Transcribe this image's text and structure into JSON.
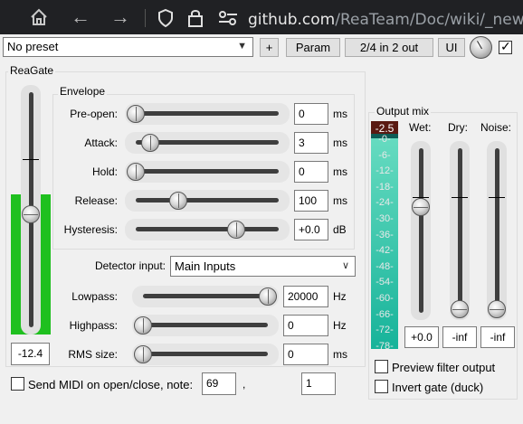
{
  "browser": {
    "url_domain": "github.com",
    "url_path": "/ReaTeam/Doc/wiki/_new"
  },
  "toolbar": {
    "preset": "No preset",
    "plus_label": "+",
    "param_label": "Param",
    "io_label": "2/4 in 2 out",
    "ui_label": "UI"
  },
  "reagate": {
    "group_label": "ReaGate",
    "threshold_value": "-12.4",
    "threshold_fill_fraction": 0.56
  },
  "envelope": {
    "group_label": "Envelope",
    "rows": [
      {
        "label": "Pre-open:",
        "value": "0",
        "unit": "ms",
        "position": 0.0
      },
      {
        "label": "Attack:",
        "value": "3",
        "unit": "ms",
        "position": 0.1
      },
      {
        "label": "Hold:",
        "value": "0",
        "unit": "ms",
        "position": 0.0
      },
      {
        "label": "Release:",
        "value": "100",
        "unit": "ms",
        "position": 0.3
      },
      {
        "label": "Hysteresis:",
        "value": "+0.0",
        "unit": "dB",
        "position": 0.7
      }
    ]
  },
  "detector": {
    "label": "Detector input:",
    "value": "Main Inputs"
  },
  "filters": {
    "rows": [
      {
        "label": "Lowpass:",
        "value": "20000",
        "unit": "Hz",
        "position": 1.0
      },
      {
        "label": "Highpass:",
        "value": "0",
        "unit": "Hz",
        "position": 0.0
      },
      {
        "label": "RMS size:",
        "value": "0",
        "unit": "ms",
        "position": 0.0
      }
    ]
  },
  "midi": {
    "label": "Send MIDI on open/close, note:",
    "note": "69",
    "separator": ",",
    "channel": "1",
    "checked": false
  },
  "output_mix": {
    "group_label": "Output mix",
    "meter_peak": "-2.5",
    "meter_scale": [
      "-0-",
      "-6-",
      "-12-",
      "-18-",
      "-24-",
      "-30-",
      "-36-",
      "-42-",
      "-48-",
      "-54-",
      "-60-",
      "-66-",
      "-72-",
      "-78-"
    ],
    "meter_level_fraction": 0.98,
    "wet": {
      "label": "Wet:",
      "value": "+0.0",
      "position": 0.35
    },
    "dry": {
      "label": "Dry:",
      "value": "-inf",
      "position": 1.0
    },
    "noise": {
      "label": "Noise:",
      "value": "-inf",
      "position": 1.0
    },
    "preview_label": "Preview filter output",
    "invert_label": "Invert gate (duck)",
    "preview_checked": false,
    "invert_checked": false
  },
  "colors": {
    "level_green": "#1fc01f",
    "meter_bg": "#0f5c55",
    "meter_peak_bg": "#5a1a12"
  }
}
